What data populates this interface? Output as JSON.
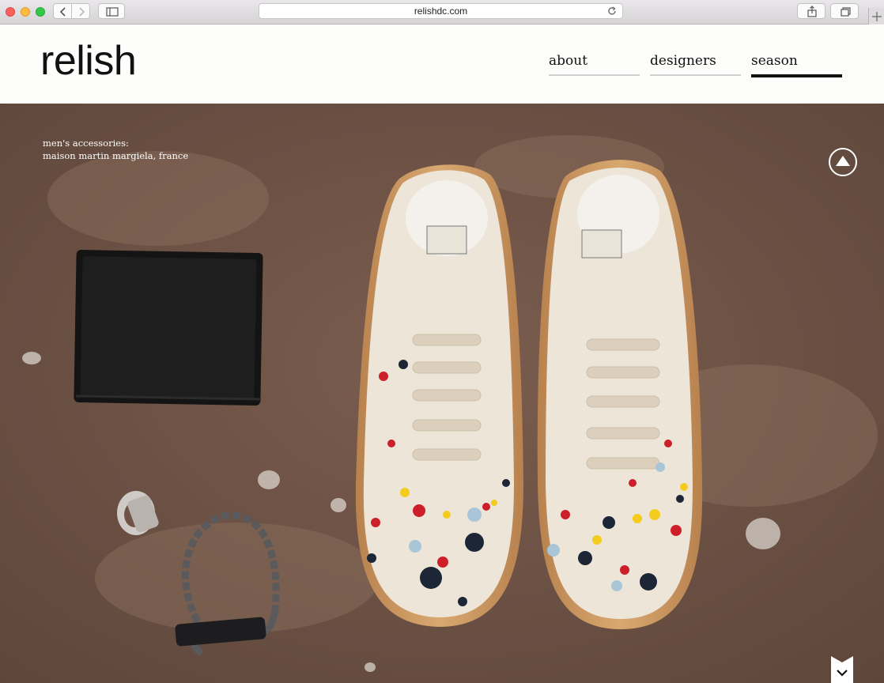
{
  "browser": {
    "url": "relishdc.com",
    "icons": [
      "back-icon",
      "forward-icon",
      "sidebar-icon",
      "reload-icon",
      "share-icon",
      "tabs-icon",
      "new-tab-icon"
    ]
  },
  "site": {
    "logo": "relish",
    "nav": [
      {
        "label": "about",
        "active": false
      },
      {
        "label": "designers",
        "active": false
      },
      {
        "label": "season",
        "active": true
      }
    ]
  },
  "hero": {
    "caption_line1": "men's accessories:",
    "caption_line2": "maison martin margiela, france"
  }
}
